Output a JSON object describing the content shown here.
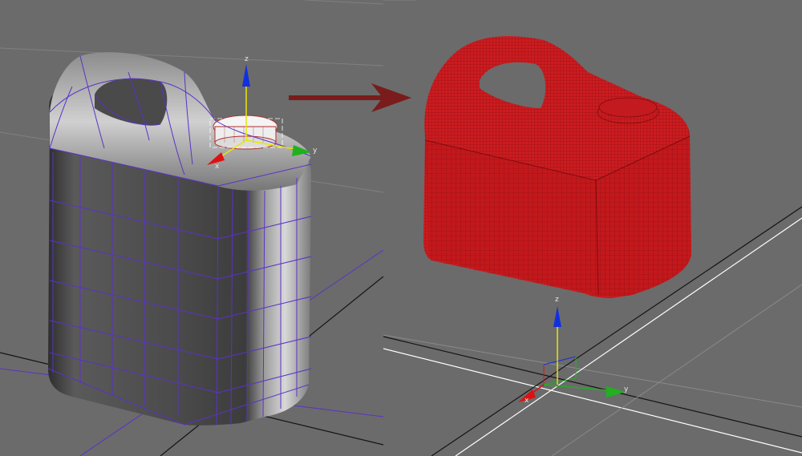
{
  "viewport_left": {
    "background": "#6b6b6b",
    "object": "jerry-can-low-poly-cage",
    "wire_color": "#5a32c8",
    "gizmo": {
      "x_label": "x",
      "y_label": "y",
      "z_label": "z"
    }
  },
  "transition": {
    "icon": "right-arrow-icon",
    "color": "#7a1c1c"
  },
  "viewport_right": {
    "background": "#6b6b6b",
    "object": "jerry-can-subdivided-mesh",
    "mesh_color": "#c2181c",
    "gizmo": {
      "x_label": "x",
      "y_label": "y",
      "z_label": "z"
    }
  },
  "colors": {
    "axis_x": "#e01010",
    "axis_y": "#20b020",
    "axis_z": "#1030e0",
    "grid_dark": "#1a1a1a",
    "grid_light": "#8a8a8a",
    "grid_white": "#ffffff"
  }
}
